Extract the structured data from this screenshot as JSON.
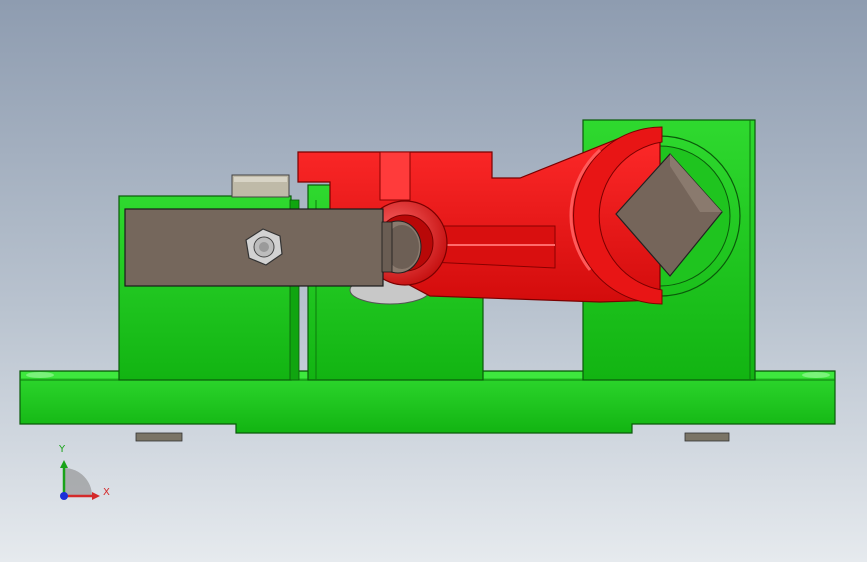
{
  "viewport": {
    "background_top": "#8e9cb0",
    "background_bottom": "#e6eaee"
  },
  "model": {
    "base_color": "#18c718",
    "clamp_color": "#e01010",
    "block_color": "#7a6a5c",
    "pad_color": "#b7b09c"
  },
  "triad": {
    "y_label": "Y",
    "x_label": "X",
    "y_color": "#19a319",
    "x_color": "#d42a2a",
    "z_color": "#1c2fd8",
    "icons": [
      "axis-y-arrow-icon",
      "axis-x-arrow-icon",
      "axis-z-dot-icon"
    ]
  }
}
